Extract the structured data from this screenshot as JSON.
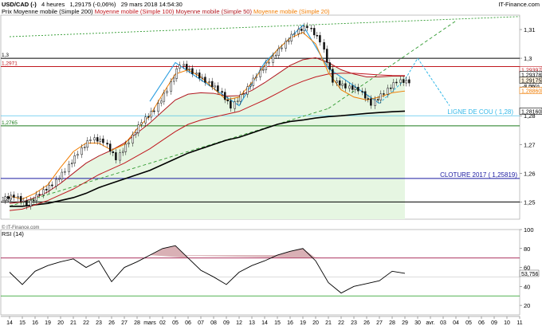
{
  "header": {
    "instrument": "USD/CAD (-)",
    "timeframe": "4 heures",
    "quote": "1,29175 (-0,06%)",
    "datetime": "29 mars 2018 14:54:30",
    "brand": "IT-Finance.com",
    "watermark": "© IT-Finance.com"
  },
  "legend": [
    {
      "label": "Prix",
      "color": "#000000"
    },
    {
      "label": "Moyenne mobile (Simple 200)",
      "color": "#000000"
    },
    {
      "label": "Moyenne mobile (Simple 100)",
      "color": "#c0181f"
    },
    {
      "label": "Moyenne mobile (Simple 50)",
      "color": "#b0181f"
    },
    {
      "label": "Moyenne mobile (Simple 20)",
      "color": "#f07c00"
    }
  ],
  "price_panel": {
    "y_ticks": [
      "1,31",
      "1,3",
      "1,29",
      "1,28",
      "1,27",
      "1,26",
      "1,25"
    ],
    "levels": [
      {
        "label": "1,3",
        "value": 1.3,
        "color": "#000000"
      },
      {
        "label": "1,2971",
        "value": 1.2971,
        "color": "#c0181f"
      },
      {
        "label": "1,2765",
        "value": 1.2765,
        "color": "#1a7a1a"
      },
      {
        "label": "CLOTURE 2017 ( 1,25819)",
        "value": 1.25819,
        "color": "#1a1aa0"
      },
      {
        "label": "1,25",
        "value": 1.25,
        "color": "#000000"
      },
      {
        "label": "LIGNE DE  COU ( 1,28)",
        "value": 1.28,
        "color": "#33b8e8"
      }
    ],
    "value_tags": [
      {
        "label": "1,29397",
        "value": 1.29397,
        "color": "#c0181f"
      },
      {
        "label": "1,29378",
        "value": 1.29378,
        "color": "#000000"
      },
      {
        "label": "1,29175",
        "value": 1.29175,
        "color": "#000000"
      },
      {
        "label": "-0,06%",
        "value": 1.29,
        "color": "#333333"
      },
      {
        "label": "1,28860",
        "value": 1.2886,
        "color": "#f07c00"
      },
      {
        "label": "1,28160",
        "value": 1.2816,
        "color": "#000000"
      }
    ]
  },
  "rsi_panel": {
    "title": "RSI (14)",
    "y_ticks": [
      "100",
      "80",
      "60",
      "40",
      "20"
    ],
    "levels": [
      70,
      30
    ],
    "value_tag": "53,756"
  },
  "x_axis": {
    "labels": [
      "14",
      "15",
      "16",
      "19",
      "20",
      "21",
      "22",
      "23",
      "26",
      "27",
      "28",
      "mars",
      "02",
      "05",
      "06",
      "07",
      "08",
      "09",
      "12",
      "13",
      "14",
      "15",
      "16",
      "19",
      "20",
      "21",
      "22",
      "23",
      "26",
      "27",
      "28",
      "29",
      "30",
      "avr.",
      "03",
      "04",
      "05",
      "06",
      "09",
      "10",
      "11"
    ]
  },
  "chart_data": [
    {
      "type": "candlestick",
      "title": "USD/CAD (-) 4 heures",
      "x": [
        "14",
        "15",
        "16",
        "19",
        "20",
        "21",
        "22",
        "23",
        "26",
        "27",
        "28",
        "mars",
        "02",
        "05",
        "06",
        "07",
        "08",
        "09",
        "12",
        "13",
        "14",
        "15",
        "16",
        "19",
        "20",
        "21",
        "22",
        "23",
        "26",
        "27",
        "28",
        "29"
      ],
      "close": [
        1.252,
        1.249,
        1.253,
        1.256,
        1.261,
        1.267,
        1.272,
        1.271,
        1.265,
        1.271,
        1.278,
        1.282,
        1.289,
        1.298,
        1.295,
        1.292,
        1.289,
        1.283,
        1.288,
        1.294,
        1.299,
        1.304,
        1.309,
        1.311,
        1.306,
        1.292,
        1.29,
        1.289,
        1.284,
        1.288,
        1.292,
        1.2918
      ],
      "series": [
        {
          "name": "Moyenne mobile (Simple 200)",
          "values": [
            1.2485,
            1.2485,
            1.249,
            1.2495,
            1.2505,
            1.2515,
            1.253,
            1.255,
            1.2565,
            1.258,
            1.2595,
            1.261,
            1.263,
            1.265,
            1.267,
            1.2685,
            1.27,
            1.2715,
            1.2725,
            1.274,
            1.2755,
            1.277,
            1.278,
            1.2785,
            1.2792,
            1.2797,
            1.28,
            1.2804,
            1.2808,
            1.2811,
            1.2814,
            1.2816
          ]
        },
        {
          "name": "Moyenne mobile (Simple 100)",
          "values": [
            1.247,
            1.2475,
            1.249,
            1.2505,
            1.2525,
            1.2545,
            1.257,
            1.2595,
            1.2615,
            1.2635,
            1.266,
            1.2685,
            1.2715,
            1.2745,
            1.277,
            1.2785,
            1.2795,
            1.2805,
            1.2815,
            1.2835,
            1.2855,
            1.2878,
            1.2902,
            1.292,
            1.2935,
            1.2945,
            1.2948,
            1.2948,
            1.2945,
            1.2942,
            1.294,
            1.29397
          ]
        },
        {
          "name": "Moyenne mobile (Simple 50)",
          "values": [
            1.2495,
            1.25,
            1.2515,
            1.2535,
            1.2565,
            1.26,
            1.2635,
            1.266,
            1.268,
            1.2705,
            1.274,
            1.2775,
            1.2815,
            1.2855,
            1.2875,
            1.288,
            1.2878,
            1.2868,
            1.287,
            1.2888,
            1.2915,
            1.2945,
            1.2975,
            1.2995,
            1.3002,
            1.2985,
            1.296,
            1.2945,
            1.2935,
            1.2935,
            1.2938,
            1.29378
          ]
        },
        {
          "name": "Moyenne mobile (Simple 20)",
          "values": [
            1.252,
            1.251,
            1.253,
            1.256,
            1.262,
            1.2675,
            1.2705,
            1.2705,
            1.268,
            1.27,
            1.2755,
            1.28,
            1.2875,
            1.2945,
            1.296,
            1.2935,
            1.2895,
            1.2855,
            1.2865,
            1.2915,
            1.2975,
            1.303,
            1.307,
            1.309,
            1.305,
            1.295,
            1.289,
            1.2865,
            1.2855,
            1.2865,
            1.288,
            1.2886
          ]
        }
      ],
      "ylim": [
        1.244,
        1.315
      ]
    },
    {
      "type": "line",
      "title": "RSI (14)",
      "x": [
        "14",
        "15",
        "16",
        "19",
        "20",
        "21",
        "22",
        "23",
        "26",
        "27",
        "28",
        "mars",
        "02",
        "05",
        "06",
        "07",
        "08",
        "09",
        "12",
        "13",
        "14",
        "15",
        "16",
        "19",
        "20",
        "21",
        "22",
        "23",
        "26",
        "27",
        "28",
        "29"
      ],
      "series": [
        {
          "name": "RSI (14)",
          "values": [
            55,
            42,
            56,
            62,
            66,
            69,
            60,
            67,
            45,
            60,
            66,
            73,
            80,
            83,
            70,
            57,
            50,
            42,
            55,
            62,
            67,
            73,
            77,
            80,
            67,
            44,
            33,
            40,
            43,
            46,
            56,
            53.756
          ]
        }
      ],
      "ylim": [
        10,
        100
      ],
      "levels": [
        70,
        30
      ]
    }
  ]
}
